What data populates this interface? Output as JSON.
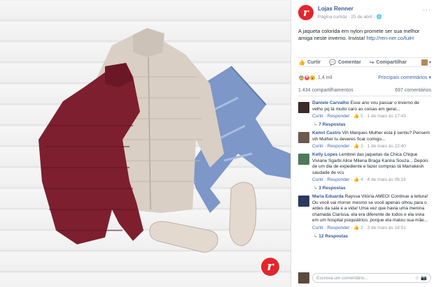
{
  "post": {
    "page_name": "Lojas Renner",
    "meta": "Página curtida · 25 de abril · 🌐",
    "text": "A jaqueta colorida em nylon promete ser sua melhor amiga neste inverno. Invista! ",
    "link": "http://ren-ner.co/luiH",
    "brand_letter": "r",
    "more": "···"
  },
  "actions": {
    "like": "Curtir",
    "comment": "Comentar",
    "share": "Compartilhar",
    "caret": "▾"
  },
  "reactions": {
    "count": "1,4 mil",
    "sort": "Principais comentários ▾"
  },
  "counts": {
    "shares": "1.434 compartilhamentos",
    "comments": "697 comentários"
  },
  "comments": [
    {
      "name": "Daniele Carvalho",
      "text": "Esse ano vou passar o inverno de velho pq tá muito caro as coisas em geral...",
      "meta_prefix": "Curtir · Responder · ",
      "meta_suffix": "👍 5 · 1 de maio às 17:43",
      "replies": "7 Respostas",
      "avatar": "#3a2a2a"
    },
    {
      "name": "Kemri Castro",
      "text": "Vih Marques Mulher esta ji sentiu? Pensem vih Mulher tu deveres ficar comigo...",
      "meta_prefix": "Curtir · Responder · ",
      "meta_suffix": "👍 3 · 1 de maio às 22:40",
      "replies": "",
      "avatar": "#6d5a4e"
    },
    {
      "name": "Kelly Lopes",
      "text": "Lembrei das jaquetas da Chica Chique Viviane Sgarbi Alice Milena Braga Karina Souza... Depois de um dia de expediente e fazer compras tá Marrakesh saudade de vcs",
      "meta_prefix": "Curtir · Responder · ",
      "meta_suffix": "👍 4 · 4 de maio às 08:16",
      "replies": "3 Respostas",
      "avatar": "#4d7a5a"
    },
    {
      "name": "Maria Eduarda",
      "text": "Rayssa Vitória AMEO! Continue a leitura! Ou você vai morrer mesmo se você apenas olhou para o antes da sala e a vida! Uma vez que havia uma menina chamada Clarissa, ela era diferente de todos e ela vivia em um hospital psiquiátrico, porque ela matou sua mãe...",
      "meta_prefix": "Curtir · Responder · ",
      "meta_suffix": "👍 2 · 3 de maio às 18:51",
      "replies": "12 Respostas",
      "avatar": "#2b3a5c"
    }
  ],
  "comment_box": {
    "placeholder": "Escreva um comentário...",
    "icons": "☺ 📷"
  },
  "colors": {
    "brand_red": "#e3262c",
    "link_blue": "#365899",
    "jacket_red": "#7d1f2e",
    "jacket_beige": "#d9cfc5",
    "jeans": "#7c97c8"
  }
}
